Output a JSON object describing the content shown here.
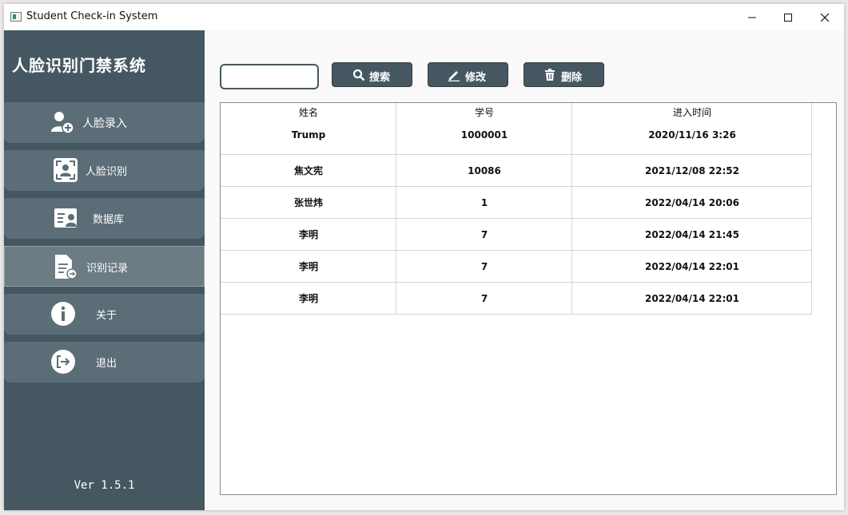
{
  "window": {
    "title": "Student Check-in System"
  },
  "sidebar": {
    "system_title": "人脸识别门禁系统",
    "items": [
      {
        "label": "人脸录入",
        "icon": "add-user-icon"
      },
      {
        "label": "人脸识别",
        "icon": "face-scan-icon"
      },
      {
        "label": "数据库",
        "icon": "id-card-icon"
      },
      {
        "label": "识别记录",
        "icon": "record-document-icon"
      },
      {
        "label": "关于",
        "icon": "info-icon"
      },
      {
        "label": "退出",
        "icon": "exit-icon"
      }
    ],
    "active_index": 3,
    "version": "Ver 1.5.1"
  },
  "toolbar": {
    "search_value": "",
    "search_label": "搜索",
    "edit_label": "修改",
    "delete_label": "删除"
  },
  "table": {
    "columns": [
      "姓名",
      "学号",
      "进入时间"
    ],
    "rows": [
      [
        "Trump",
        "1000001",
        "2020/11/16 3:26"
      ],
      [
        "焦文宪",
        "10086",
        "2021/12/08 22:52"
      ],
      [
        "张世炜",
        "1",
        "2022/04/14 20:06"
      ],
      [
        "李明",
        "7",
        "2022/04/14 21:45"
      ],
      [
        "李明",
        "7",
        "2022/04/14 22:01"
      ],
      [
        "李明",
        "7",
        "2022/04/14 22:01"
      ]
    ]
  },
  "colors": {
    "sidebar_bg": "#455862",
    "nav_item_bg": "#5b6d76",
    "button_bg": "#455862"
  }
}
